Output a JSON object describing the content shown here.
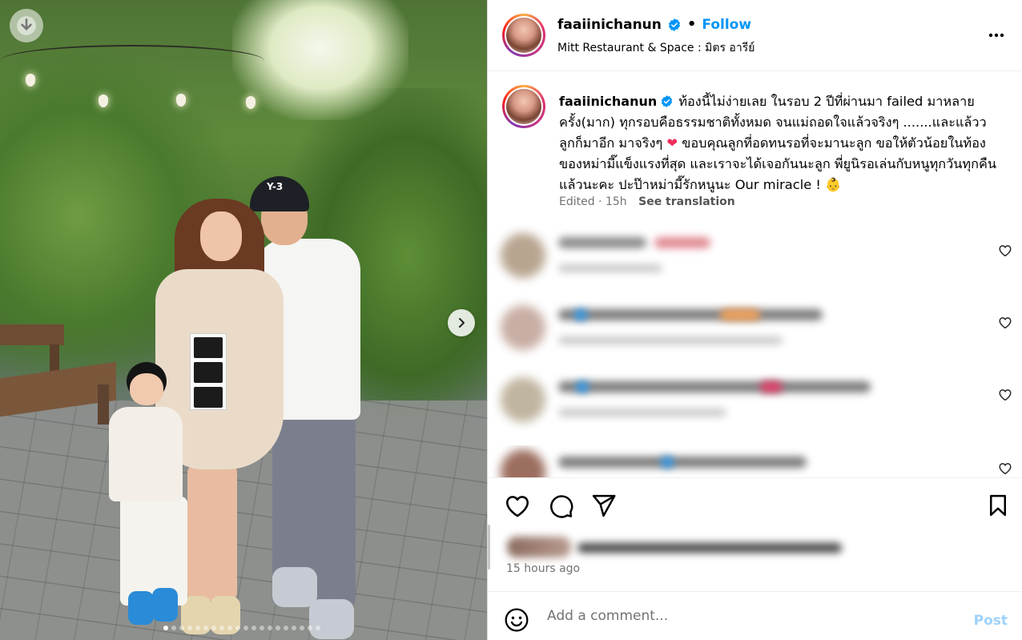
{
  "post": {
    "username": "faaiinichanun",
    "separator": "•",
    "follow_label": "Follow",
    "location": "Mitt Restaurant & Space : มิตร อารีย์"
  },
  "caption": {
    "username": "faaiinichanun",
    "text_part1": "ท้องนี้ไม่ง่ายเลย ในรอบ 2 ปีที่ผ่านมา failed มาหลายครั้ง(มาก) ทุกรอบคือธรรมชาติทั้งหมด จนแม่ถอดใจแล้วจริงๆ .......และแล้ววลูกก็มาอีก มาจริงๆ",
    "heart": "❤",
    "text_part2": "ขอบคุณลูกที่อดทนรอที่จะมานะลูก ขอให้ตัวน้อยในท้องของหม่ามี๊แข็งแรงที่สุด และเราจะได้เจอกันนะลูก พี่ยูนิรอเล่นกับหนูทุกวันทุกคืนแล้วนะคะ ปะป๊าหม่ามี๊รักหนูนะ Our miracle !",
    "baby": "👶",
    "edited": "Edited · 15h",
    "see_translation": "See translation"
  },
  "photo": {
    "cap_text": "Y-3"
  },
  "footer": {
    "time_ago": "15 hours ago",
    "comment_placeholder": "Add a comment...",
    "post_label": "Post"
  },
  "comments_blurred_colors": [
    "#e08a92",
    "#2f9bf0",
    "#f5a25a",
    "#e23f6a"
  ],
  "colors": {
    "accent": "#0095f6",
    "post_disabled": "#9dd2fb",
    "muted": "#737373"
  }
}
